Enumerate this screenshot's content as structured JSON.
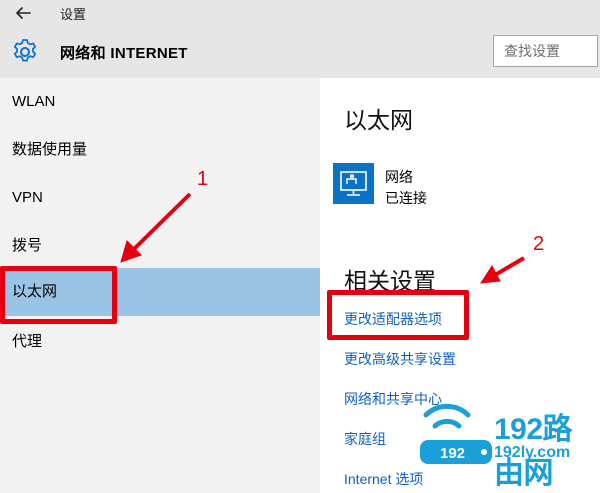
{
  "window": {
    "title": "设置"
  },
  "header": {
    "section_title": "网络和 INTERNET"
  },
  "search": {
    "placeholder": "查找设置"
  },
  "sidebar": {
    "items": [
      {
        "label": "WLAN"
      },
      {
        "label": "数据使用量"
      },
      {
        "label": "VPN"
      },
      {
        "label": "拨号"
      },
      {
        "label": "以太网",
        "selected": true
      },
      {
        "label": "代理"
      }
    ]
  },
  "main": {
    "title": "以太网",
    "ethernet": {
      "name": "网络",
      "status": "已连接"
    },
    "related_title": "相关设置",
    "links": [
      "更改适配器选项",
      "更改高级共享设置",
      "网络和共享中心",
      "家庭组",
      "Internet 选项"
    ]
  },
  "annotations": {
    "marker_1": "1",
    "marker_2": "2"
  },
  "watermark": {
    "brand": "192路由网",
    "ip": "192",
    "domain": "192ly.com"
  },
  "colors": {
    "accent": "#0a73c6",
    "selected": "#99c4e6",
    "link": "#1060c4",
    "annotation": "#e4000f",
    "watermark": "#1a9fd9"
  },
  "icons": {
    "back": "back-arrow-icon",
    "settings": "gear-icon",
    "ethernet": "ethernet-monitor-icon",
    "watermark": "wifi-router-icon"
  }
}
